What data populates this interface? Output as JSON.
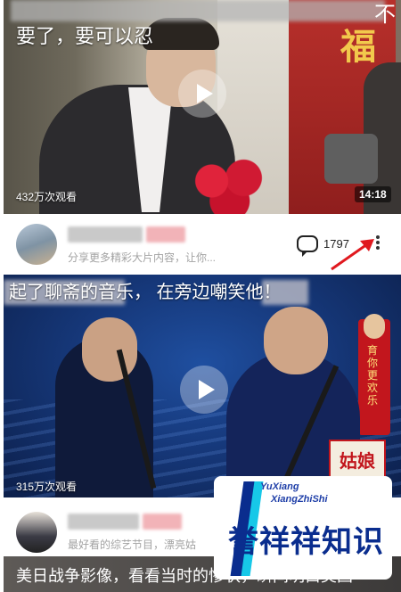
{
  "video1": {
    "caption": "要了，要可以忍",
    "views": "432万次观看",
    "duration": "14:18",
    "fu_char": "福",
    "close_glyph": "不"
  },
  "item1": {
    "description": "分享更多精彩大片内容，让你...",
    "comment_count": "1797"
  },
  "video2": {
    "caption": "起了聊斋的音乐，        在旁边嘲笑他！",
    "views": "315万次观看",
    "banner_text": "育你更欢乐",
    "logo_text": "姑娘"
  },
  "item2": {
    "description": "最好看的综艺节目，漂亮姑"
  },
  "bottom": {
    "caption": "美日战争影像，看看当时的惨状，瞬间明白美国"
  },
  "watermark": {
    "latin_line1": "YuXiang",
    "latin_line2": "XiangZhiShi",
    "chinese": "誉祥祥知识"
  },
  "colors": {
    "arrow_red": "#e0191f",
    "desc_gray": "#a3a3a3",
    "watermark_blue": "#0a2d8e",
    "watermark_cyan": "#17c8e8"
  },
  "icons": [
    "play-icon",
    "comment-icon",
    "more-vertical-icon",
    "close-icon"
  ]
}
